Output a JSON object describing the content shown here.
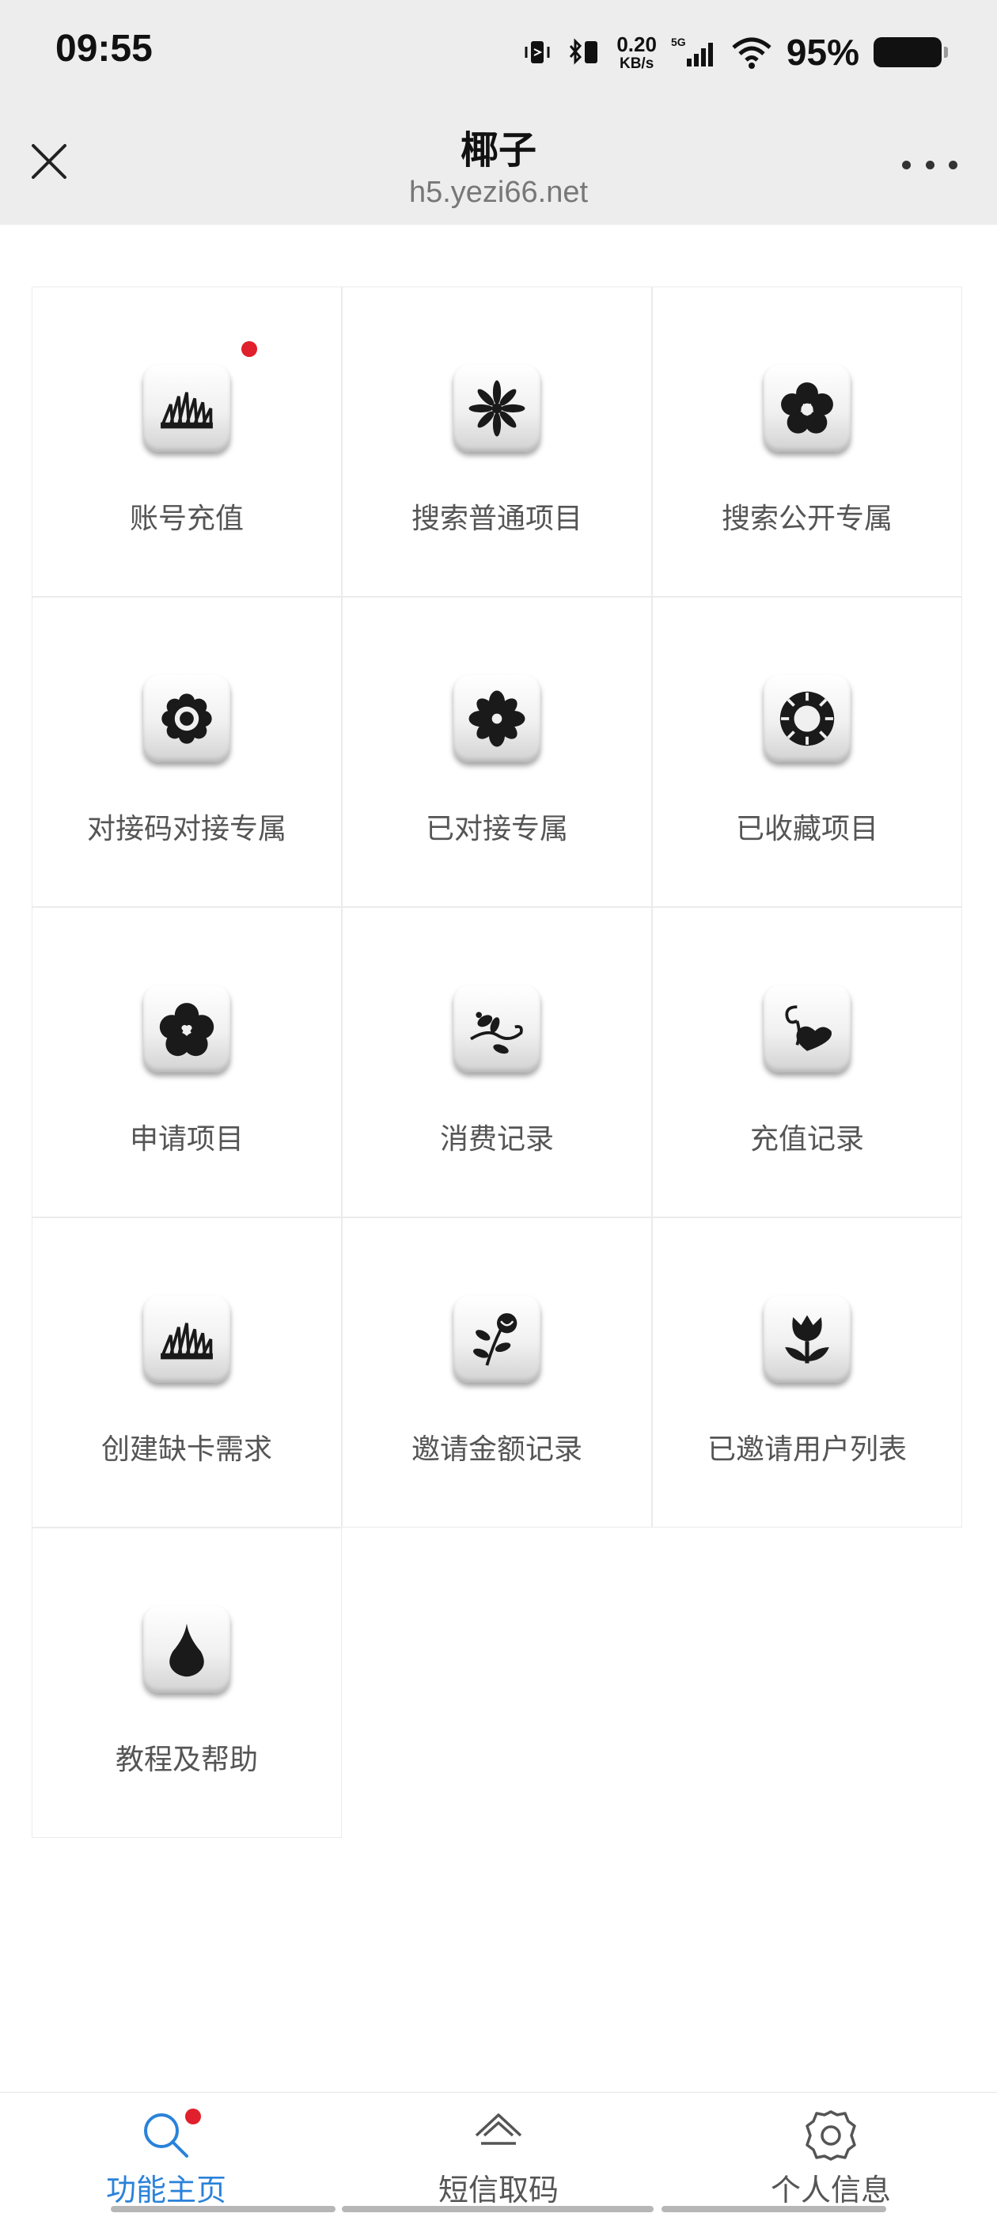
{
  "status_bar": {
    "time": "09:55",
    "net_speed_value": "0.20",
    "net_speed_unit": "KB/s",
    "network": "5G",
    "battery_percent": "95%"
  },
  "header": {
    "title": "椰子",
    "url": "h5.yezi66.net"
  },
  "grid": {
    "items": [
      {
        "label": "账号充值",
        "icon": "grass-icon",
        "badge": true
      },
      {
        "label": "搜索普通项目",
        "icon": "star-flower-icon"
      },
      {
        "label": "搜索公开专属",
        "icon": "flower-icon"
      },
      {
        "label": "对接码对接专属",
        "icon": "daisy-icon"
      },
      {
        "label": "已对接专属",
        "icon": "blossom-icon"
      },
      {
        "label": "已收藏项目",
        "icon": "sun-icon"
      },
      {
        "label": "申请项目",
        "icon": "heart-flower-icon"
      },
      {
        "label": "消费记录",
        "icon": "vine-icon"
      },
      {
        "label": "充值记录",
        "icon": "heart-swirl-icon"
      },
      {
        "label": "创建缺卡需求",
        "icon": "grass-icon"
      },
      {
        "label": "邀请金额记录",
        "icon": "rose-icon"
      },
      {
        "label": "已邀请用户列表",
        "icon": "tulip-icon"
      },
      {
        "label": "教程及帮助",
        "icon": "drop-icon"
      }
    ]
  },
  "tabbar": {
    "tabs": [
      {
        "label": "功能主页",
        "icon": "search-icon",
        "active": true,
        "badge": true
      },
      {
        "label": "短信取码",
        "icon": "home-icon"
      },
      {
        "label": "个人信息",
        "icon": "gear-icon"
      }
    ]
  },
  "colors": {
    "accent": "#2a82d9",
    "badge": "#e0202c",
    "header_bg": "#ededed"
  }
}
